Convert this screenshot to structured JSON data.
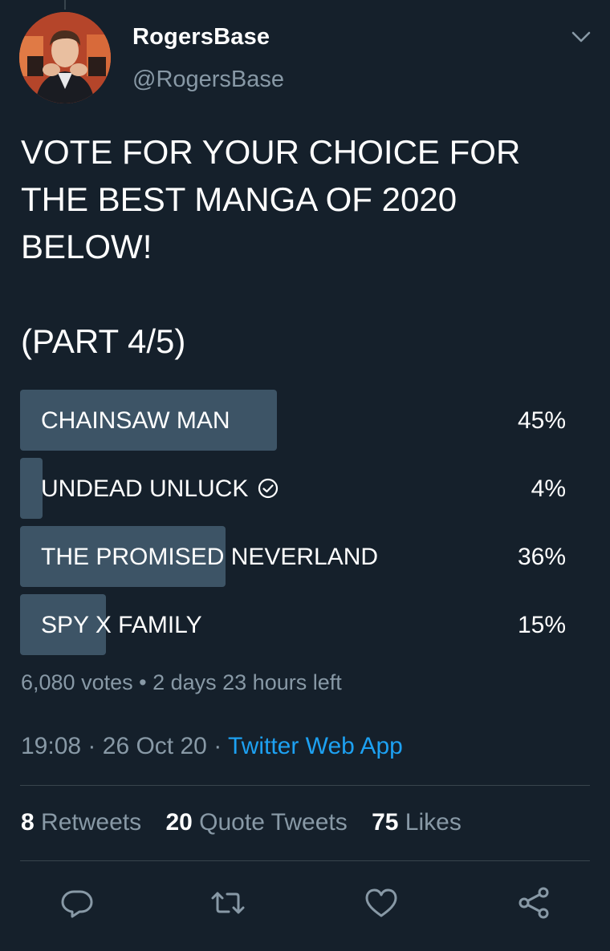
{
  "user": {
    "display_name": "RogersBase",
    "handle": "@RogersBase"
  },
  "tweet": {
    "text": "VOTE FOR YOUR CHOICE FOR\nTHE BEST MANGA OF 2020\nBELOW!\n\n(PART 4/5)"
  },
  "poll": {
    "options": [
      {
        "label": "CHAINSAW MAN",
        "percent": "45%",
        "share": 45
      },
      {
        "label": "UNDEAD UNLUCK",
        "percent": "4%",
        "share": 4,
        "selected": true
      },
      {
        "label": "THE PROMISED NEVERLAND",
        "percent": "36%",
        "share": 36
      },
      {
        "label": "SPY X FAMILY",
        "percent": "15%",
        "share": 15
      }
    ],
    "votes": "6,080 votes",
    "separator": "•",
    "time_left": "2 days 23 hours left"
  },
  "timestamp": {
    "time": "19:08",
    "dot": "·",
    "date": "26 Oct 20",
    "app": "Twitter Web App"
  },
  "stats": {
    "retweets_count": "8",
    "retweets_label": "Retweets",
    "quotes_count": "20",
    "quotes_label": "Quote Tweets",
    "likes_count": "75",
    "likes_label": "Likes"
  },
  "icons": {
    "caret": "chevron-down-icon",
    "check": "check-circle-icon",
    "reply": "reply-icon",
    "retweet": "retweet-icon",
    "like": "heart-icon",
    "share": "share-icon"
  },
  "colors": {
    "background": "#15202b",
    "poll_bar": "#3d5466",
    "secondary_text": "#8899a6",
    "link": "#1da1f2",
    "divider": "#38444d"
  }
}
